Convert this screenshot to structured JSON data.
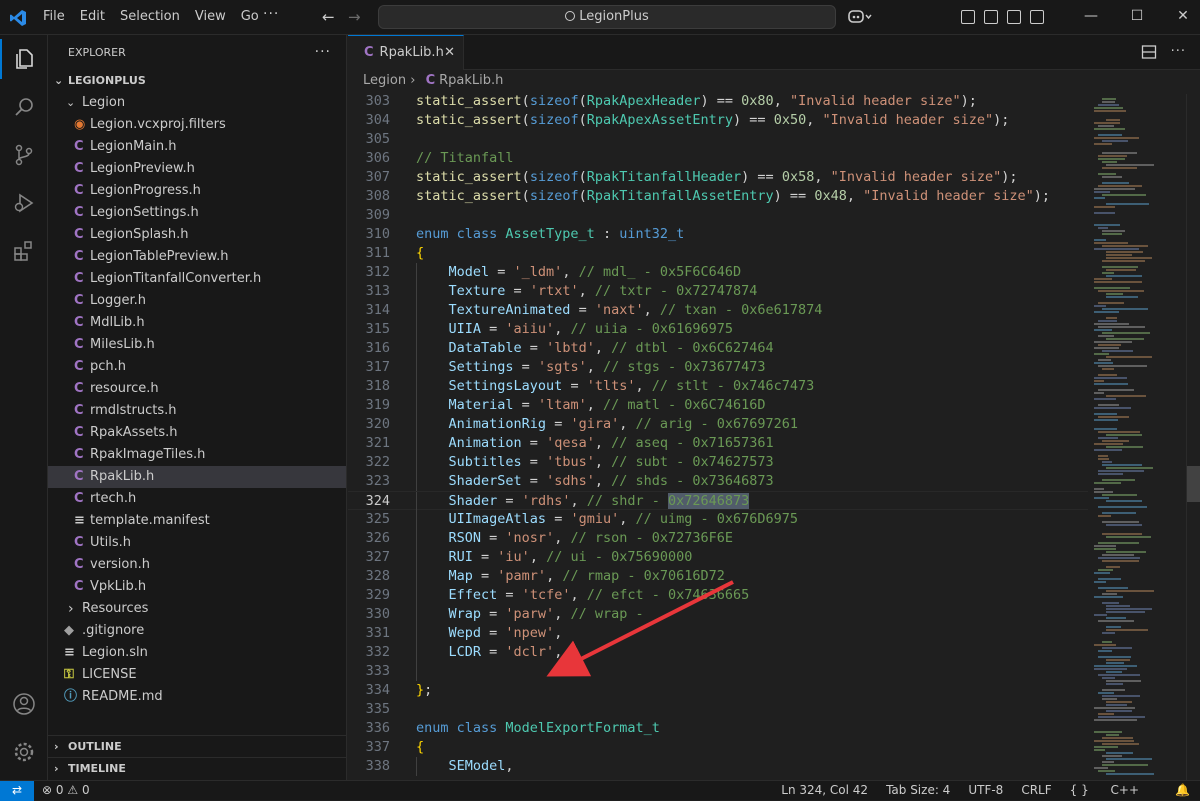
{
  "titlebar": {
    "menu": [
      "File",
      "Edit",
      "Selection",
      "View",
      "Go"
    ],
    "more": "···",
    "search": "LegionPlus"
  },
  "explorer": {
    "title": "EXPLORER",
    "workspace": "LEGIONPLUS",
    "folder": "Legion",
    "files": [
      {
        "name": "Legion.vcxproj.filters",
        "icon": "rss-icon"
      },
      {
        "name": "LegionMain.h",
        "icon": "c-icon"
      },
      {
        "name": "LegionPreview.h",
        "icon": "c-icon"
      },
      {
        "name": "LegionProgress.h",
        "icon": "c-icon"
      },
      {
        "name": "LegionSettings.h",
        "icon": "c-icon"
      },
      {
        "name": "LegionSplash.h",
        "icon": "c-icon"
      },
      {
        "name": "LegionTablePreview.h",
        "icon": "c-icon"
      },
      {
        "name": "LegionTitanfallConverter.h",
        "icon": "c-icon"
      },
      {
        "name": "Logger.h",
        "icon": "c-icon"
      },
      {
        "name": "MdlLib.h",
        "icon": "c-icon"
      },
      {
        "name": "MilesLib.h",
        "icon": "c-icon"
      },
      {
        "name": "pch.h",
        "icon": "c-icon"
      },
      {
        "name": "resource.h",
        "icon": "c-icon"
      },
      {
        "name": "rmdlstructs.h",
        "icon": "c-icon"
      },
      {
        "name": "RpakAssets.h",
        "icon": "c-icon"
      },
      {
        "name": "RpakImageTiles.h",
        "icon": "c-icon"
      },
      {
        "name": "RpakLib.h",
        "icon": "c-icon"
      },
      {
        "name": "rtech.h",
        "icon": "c-icon"
      },
      {
        "name": "template.manifest",
        "icon": "lines-icon"
      },
      {
        "name": "Utils.h",
        "icon": "c-icon"
      },
      {
        "name": "version.h",
        "icon": "c-icon"
      },
      {
        "name": "VpkLib.h",
        "icon": "c-icon"
      }
    ],
    "root_items": [
      {
        "name": "Resources",
        "icon": "chevron-right-icon"
      },
      {
        "name": ".gitignore",
        "icon": "git-icon"
      },
      {
        "name": "Legion.sln",
        "icon": "lines-icon"
      },
      {
        "name": "LICENSE",
        "icon": "key-icon"
      },
      {
        "name": "README.md",
        "icon": "info-icon"
      }
    ],
    "outline": "OUTLINE",
    "timeline": "TIMELINE"
  },
  "editor": {
    "tab": "RpakLib.h",
    "breadcrumb": [
      "Legion",
      "RpakLib.h"
    ],
    "current_line": "324",
    "lines": [
      {
        "n": "303",
        "tokens": [
          [
            "fn",
            "static_assert"
          ],
          [
            "pl",
            "("
          ],
          [
            "kw",
            "sizeof"
          ],
          [
            "pl",
            "("
          ],
          [
            "ty",
            "RpakApexHeader"
          ],
          [
            "pl",
            ") == "
          ],
          [
            "num",
            "0x80"
          ],
          [
            "pl",
            ", "
          ],
          [
            "str",
            "\"Invalid header size\""
          ],
          [
            "pl",
            ");"
          ]
        ]
      },
      {
        "n": "304",
        "tokens": [
          [
            "fn",
            "static_assert"
          ],
          [
            "pl",
            "("
          ],
          [
            "kw",
            "sizeof"
          ],
          [
            "pl",
            "("
          ],
          [
            "ty",
            "RpakApexAssetEntry"
          ],
          [
            "pl",
            ") == "
          ],
          [
            "num",
            "0x50"
          ],
          [
            "pl",
            ", "
          ],
          [
            "str",
            "\"Invalid header size\""
          ],
          [
            "pl",
            ");"
          ]
        ]
      },
      {
        "n": "305",
        "tokens": []
      },
      {
        "n": "306",
        "tokens": [
          [
            "cm",
            "// Titanfall"
          ]
        ]
      },
      {
        "n": "307",
        "tokens": [
          [
            "fn",
            "static_assert"
          ],
          [
            "pl",
            "("
          ],
          [
            "kw",
            "sizeof"
          ],
          [
            "pl",
            "("
          ],
          [
            "ty",
            "RpakTitanfallHeader"
          ],
          [
            "pl",
            ") == "
          ],
          [
            "num",
            "0x58"
          ],
          [
            "pl",
            ", "
          ],
          [
            "str",
            "\"Invalid header size\""
          ],
          [
            "pl",
            ");"
          ]
        ]
      },
      {
        "n": "308",
        "tokens": [
          [
            "fn",
            "static_assert"
          ],
          [
            "pl",
            "("
          ],
          [
            "kw",
            "sizeof"
          ],
          [
            "pl",
            "("
          ],
          [
            "ty",
            "RpakTitanfallAssetEntry"
          ],
          [
            "pl",
            ") == "
          ],
          [
            "num",
            "0x48"
          ],
          [
            "pl",
            ", "
          ],
          [
            "str",
            "\"Invalid header size\""
          ],
          [
            "pl",
            ");"
          ]
        ]
      },
      {
        "n": "309",
        "tokens": []
      },
      {
        "n": "310",
        "tokens": [
          [
            "kw",
            "enum class "
          ],
          [
            "ty",
            "AssetType_t"
          ],
          [
            "pl",
            " : "
          ],
          [
            "kw",
            "uint32_t"
          ]
        ]
      },
      {
        "n": "311",
        "tokens": [
          [
            "br",
            "{"
          ]
        ]
      },
      {
        "n": "312",
        "tokens": [
          [
            "pl",
            "    "
          ],
          [
            "var",
            "Model"
          ],
          [
            "pl",
            " = "
          ],
          [
            "str",
            "'_ldm'"
          ],
          [
            "pl",
            ", "
          ],
          [
            "cm",
            "// mdl_ - 0x5F6C646D"
          ]
        ]
      },
      {
        "n": "313",
        "tokens": [
          [
            "pl",
            "    "
          ],
          [
            "var",
            "Texture"
          ],
          [
            "pl",
            " = "
          ],
          [
            "str",
            "'rtxt'"
          ],
          [
            "pl",
            ", "
          ],
          [
            "cm",
            "// txtr - 0x72747874"
          ]
        ]
      },
      {
        "n": "314",
        "tokens": [
          [
            "pl",
            "    "
          ],
          [
            "var",
            "TextureAnimated"
          ],
          [
            "pl",
            " = "
          ],
          [
            "str",
            "'naxt'"
          ],
          [
            "pl",
            ", "
          ],
          [
            "cm",
            "// txan - 0x6e617874"
          ]
        ]
      },
      {
        "n": "315",
        "tokens": [
          [
            "pl",
            "    "
          ],
          [
            "var",
            "UIIA"
          ],
          [
            "pl",
            " = "
          ],
          [
            "str",
            "'aiiu'"
          ],
          [
            "pl",
            ", "
          ],
          [
            "cm",
            "// uiia - 0x61696975"
          ]
        ]
      },
      {
        "n": "316",
        "tokens": [
          [
            "pl",
            "    "
          ],
          [
            "var",
            "DataTable"
          ],
          [
            "pl",
            " = "
          ],
          [
            "str",
            "'lbtd'"
          ],
          [
            "pl",
            ", "
          ],
          [
            "cm",
            "// dtbl - 0x6C627464"
          ]
        ]
      },
      {
        "n": "317",
        "tokens": [
          [
            "pl",
            "    "
          ],
          [
            "var",
            "Settings"
          ],
          [
            "pl",
            " = "
          ],
          [
            "str",
            "'sgts'"
          ],
          [
            "pl",
            ", "
          ],
          [
            "cm",
            "// stgs - 0x73677473"
          ]
        ]
      },
      {
        "n": "318",
        "tokens": [
          [
            "pl",
            "    "
          ],
          [
            "var",
            "SettingsLayout"
          ],
          [
            "pl",
            " = "
          ],
          [
            "str",
            "'tlts'"
          ],
          [
            "pl",
            ", "
          ],
          [
            "cm",
            "// stlt - 0x746c7473"
          ]
        ]
      },
      {
        "n": "319",
        "tokens": [
          [
            "pl",
            "    "
          ],
          [
            "var",
            "Material"
          ],
          [
            "pl",
            " = "
          ],
          [
            "str",
            "'ltam'"
          ],
          [
            "pl",
            ", "
          ],
          [
            "cm",
            "// matl - 0x6C74616D"
          ]
        ]
      },
      {
        "n": "320",
        "tokens": [
          [
            "pl",
            "    "
          ],
          [
            "var",
            "AnimationRig"
          ],
          [
            "pl",
            " = "
          ],
          [
            "str",
            "'gira'"
          ],
          [
            "pl",
            ", "
          ],
          [
            "cm",
            "// arig - 0x67697261"
          ]
        ]
      },
      {
        "n": "321",
        "tokens": [
          [
            "pl",
            "    "
          ],
          [
            "var",
            "Animation"
          ],
          [
            "pl",
            " = "
          ],
          [
            "str",
            "'qesa'"
          ],
          [
            "pl",
            ", "
          ],
          [
            "cm",
            "// aseq - 0x71657361"
          ]
        ]
      },
      {
        "n": "322",
        "tokens": [
          [
            "pl",
            "    "
          ],
          [
            "var",
            "Subtitles"
          ],
          [
            "pl",
            " = "
          ],
          [
            "str",
            "'tbus'"
          ],
          [
            "pl",
            ", "
          ],
          [
            "cm",
            "// subt - 0x74627573"
          ]
        ]
      },
      {
        "n": "323",
        "tokens": [
          [
            "pl",
            "    "
          ],
          [
            "var",
            "ShaderSet"
          ],
          [
            "pl",
            " = "
          ],
          [
            "str",
            "'sdhs'"
          ],
          [
            "pl",
            ", "
          ],
          [
            "cm",
            "// shds - 0x73646873"
          ]
        ]
      },
      {
        "n": "324",
        "tokens": [
          [
            "pl",
            "    "
          ],
          [
            "var",
            "Shader"
          ],
          [
            "pl",
            " = "
          ],
          [
            "str",
            "'rdhs'"
          ],
          [
            "pl",
            ", "
          ],
          [
            "cm",
            "// shdr - "
          ],
          [
            "cmhl",
            "0x72646873"
          ]
        ]
      },
      {
        "n": "325",
        "tokens": [
          [
            "pl",
            "    "
          ],
          [
            "var",
            "UIImageAtlas"
          ],
          [
            "pl",
            " = "
          ],
          [
            "str",
            "'gmiu'"
          ],
          [
            "pl",
            ", "
          ],
          [
            "cm",
            "// uimg - 0x676D6975"
          ]
        ]
      },
      {
        "n": "326",
        "tokens": [
          [
            "pl",
            "    "
          ],
          [
            "var",
            "RSON"
          ],
          [
            "pl",
            " = "
          ],
          [
            "str",
            "'nosr'"
          ],
          [
            "pl",
            ", "
          ],
          [
            "cm",
            "// rson - 0x72736F6E"
          ]
        ]
      },
      {
        "n": "327",
        "tokens": [
          [
            "pl",
            "    "
          ],
          [
            "var",
            "RUI"
          ],
          [
            "pl",
            " = "
          ],
          [
            "str",
            "'iu'"
          ],
          [
            "pl",
            ", "
          ],
          [
            "cm",
            "// ui - 0x75690000"
          ]
        ]
      },
      {
        "n": "328",
        "tokens": [
          [
            "pl",
            "    "
          ],
          [
            "var",
            "Map"
          ],
          [
            "pl",
            " = "
          ],
          [
            "str",
            "'pamr'"
          ],
          [
            "pl",
            ", "
          ],
          [
            "cm",
            "// rmap - 0x70616D72"
          ]
        ]
      },
      {
        "n": "329",
        "tokens": [
          [
            "pl",
            "    "
          ],
          [
            "var",
            "Effect"
          ],
          [
            "pl",
            " = "
          ],
          [
            "str",
            "'tcfe'"
          ],
          [
            "pl",
            ", "
          ],
          [
            "cm",
            "// efct - 0x74636665"
          ]
        ]
      },
      {
        "n": "330",
        "tokens": [
          [
            "pl",
            "    "
          ],
          [
            "var",
            "Wrap"
          ],
          [
            "pl",
            " = "
          ],
          [
            "str",
            "'parw'"
          ],
          [
            "pl",
            ", "
          ],
          [
            "cm",
            "// wrap -"
          ]
        ]
      },
      {
        "n": "331",
        "tokens": [
          [
            "pl",
            "    "
          ],
          [
            "var",
            "Wepd"
          ],
          [
            "pl",
            " = "
          ],
          [
            "str",
            "'npew'"
          ],
          [
            "pl",
            ","
          ]
        ]
      },
      {
        "n": "332",
        "tokens": [
          [
            "pl",
            "    "
          ],
          [
            "var",
            "LCDR"
          ],
          [
            "pl",
            " = "
          ],
          [
            "str",
            "'dclr'"
          ],
          [
            "pl",
            ","
          ]
        ]
      },
      {
        "n": "333",
        "tokens": []
      },
      {
        "n": "334",
        "tokens": [
          [
            "br",
            "}"
          ],
          [
            "pl",
            ";"
          ]
        ]
      },
      {
        "n": "335",
        "tokens": []
      },
      {
        "n": "336",
        "tokens": [
          [
            "kw",
            "enum class "
          ],
          [
            "ty",
            "ModelExportFormat_t"
          ]
        ]
      },
      {
        "n": "337",
        "tokens": [
          [
            "br",
            "{"
          ]
        ]
      },
      {
        "n": "338",
        "tokens": [
          [
            "pl",
            "    "
          ],
          [
            "var",
            "SEModel"
          ],
          [
            "pl",
            ","
          ]
        ]
      }
    ]
  },
  "status": {
    "errors": "0",
    "warnings": "0",
    "position": "Ln 324, Col 42",
    "tab_size": "Tab Size: 4",
    "encoding": "UTF-8",
    "eol": "CRLF",
    "language": "C++",
    "braces": "{ }"
  },
  "colors": {
    "accent": "#0078d4",
    "annotation_arrow": "#e8363a"
  }
}
